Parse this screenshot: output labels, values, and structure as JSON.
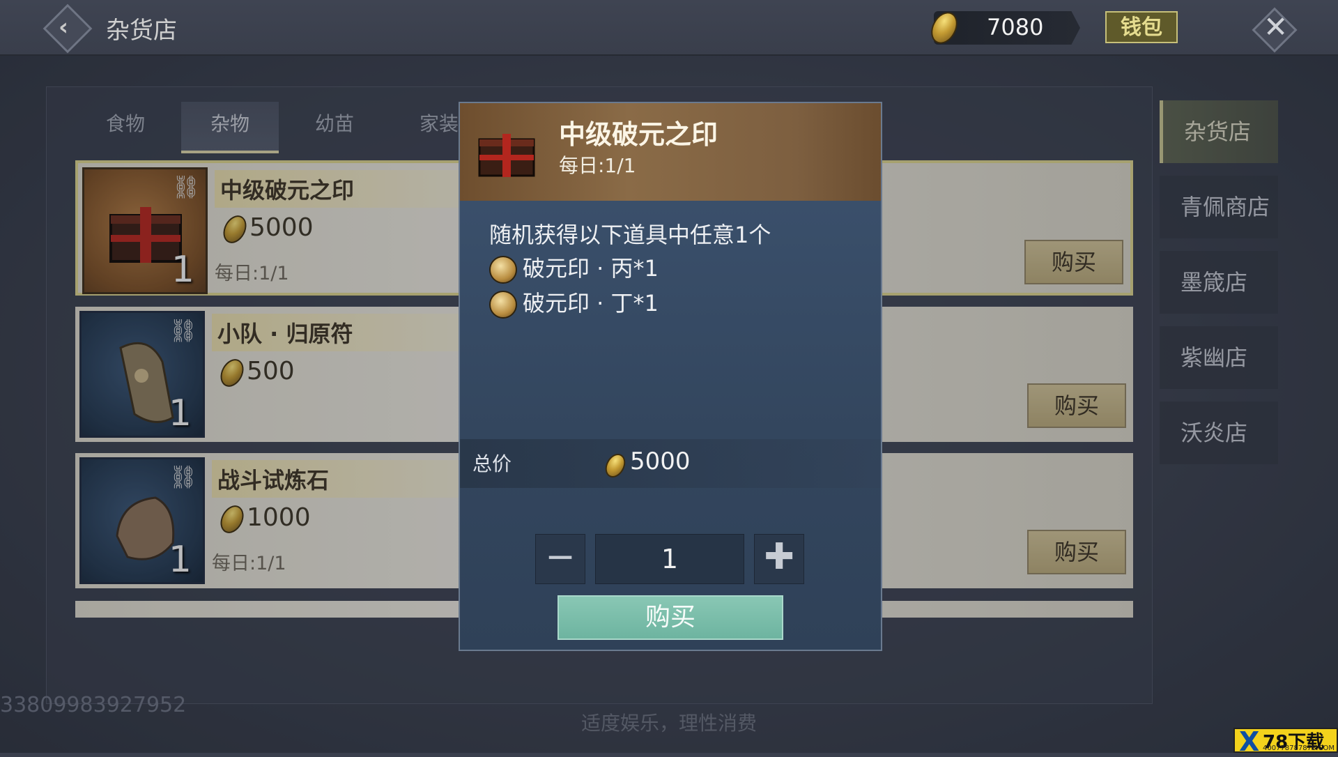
{
  "header": {
    "title": "杂货店",
    "currency_amount": "7080",
    "wallet_label": "钱包",
    "back_icon": "back-icon",
    "close_icon": "close-icon"
  },
  "tabs": [
    {
      "label": "食物",
      "active": false
    },
    {
      "label": "杂物",
      "active": true
    },
    {
      "label": "幼苗",
      "active": false
    },
    {
      "label": "家装",
      "active": false
    }
  ],
  "items": [
    {
      "name": "中级破元之印",
      "price": "5000",
      "daily": "每日:1/1",
      "qty": "1",
      "buy_label": "购买",
      "selected": true
    },
    {
      "name": "小队 · 归原符",
      "price": "500",
      "daily": "",
      "qty": "1",
      "buy_label": "购买",
      "selected": false
    },
    {
      "name": "战斗试炼石",
      "price": "1000",
      "daily": "每日:1/1",
      "qty": "1",
      "buy_label": "购买",
      "selected": false
    }
  ],
  "side_nav": [
    {
      "label": "杂货店",
      "active": true
    },
    {
      "label": "青佩商店",
      "active": false
    },
    {
      "label": "墨箴店",
      "active": false
    },
    {
      "label": "紫幽店",
      "active": false
    },
    {
      "label": "沃炎店",
      "active": false
    }
  ],
  "modal": {
    "title": "中级破元之印",
    "daily": "每日:1/1",
    "desc": "随机获得以下道具中任意1个",
    "rewards": [
      "破元印 · 丙*1",
      "破元印 · 丁*1"
    ],
    "total_label": "总价",
    "total_value": "5000",
    "quantity": "1",
    "minus": "−",
    "plus": "✚",
    "confirm_label": "购买"
  },
  "footer": {
    "id": "33809983927952",
    "notice": "适度娱乐，理性消费"
  },
  "watermark": {
    "brand": "X",
    "text": "78下载",
    "sub": "400778787878.COM"
  },
  "colors": {
    "confirm": "#6db4a0",
    "accent_gold": "#d7cf8a"
  }
}
